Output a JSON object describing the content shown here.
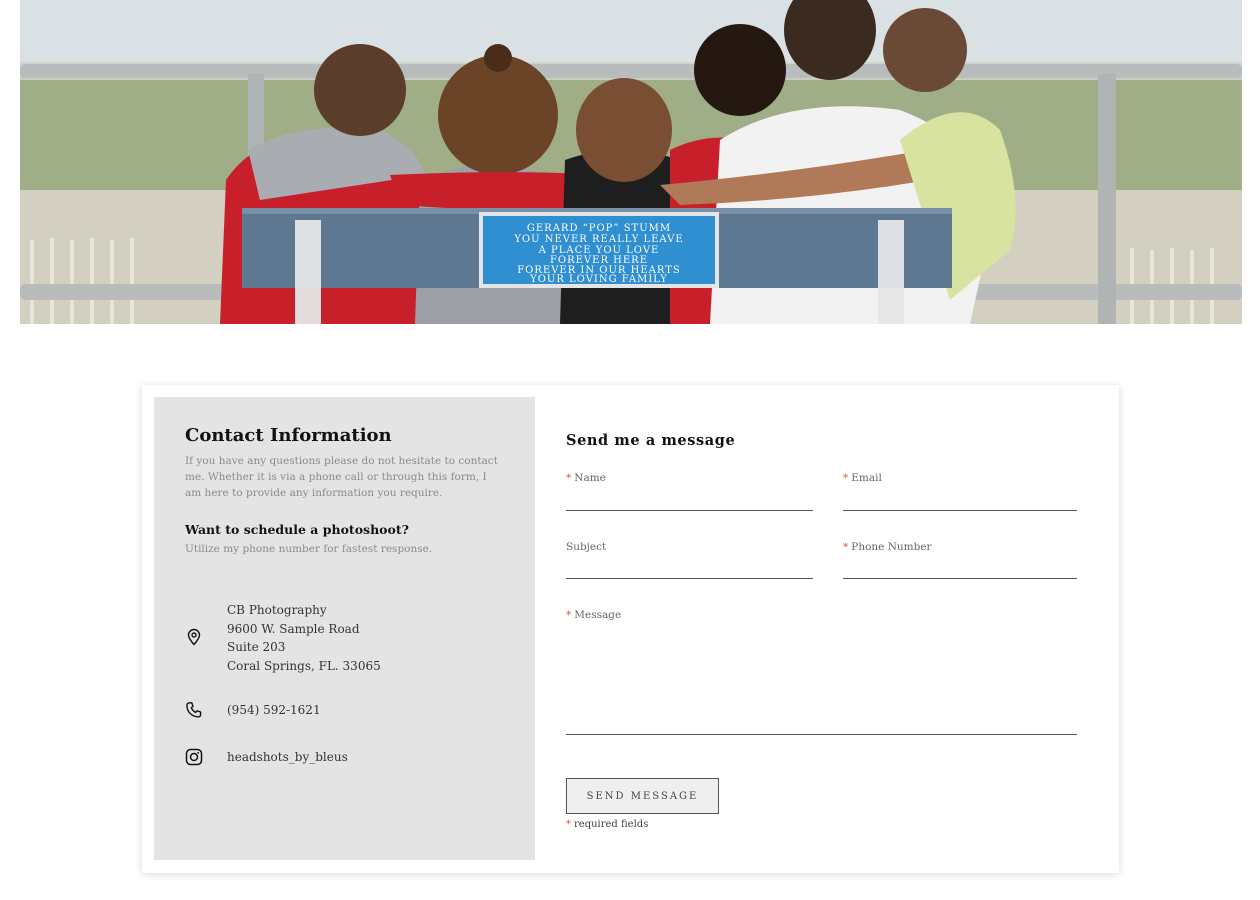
{
  "hero": {
    "plaque_lines": [
      "GERARD “POP” STUMM",
      "YOU NEVER REALLY LEAVE",
      "A PLACE YOU LOVE",
      "FOREVER HERE",
      "FOREVER IN OUR HEARTS",
      "YOUR LOVING FAMILY"
    ]
  },
  "info": {
    "title": "Contact Information",
    "intro": "If you have any questions please do not hesitate to contact me. Whether it is via a phone call or through this form, I am here to provide any information you require.",
    "schedule_title": "Want to schedule a photoshoot?",
    "schedule_note": "Utilize my phone number for fastest response.",
    "address_lines": [
      "CB Photography",
      "9600 W. Sample Road",
      "Suite 203",
      "Coral Springs, FL. 33065"
    ],
    "phone": "(954) 592-1621",
    "instagram": "headshots_by_bleus",
    "icons": {
      "address": "map-pin-icon",
      "phone": "phone-icon",
      "instagram": "instagram-icon"
    }
  },
  "form": {
    "title": "Send me a message",
    "required_mark": "*",
    "fields": {
      "name": {
        "label": "Name",
        "value": ""
      },
      "email": {
        "label": "Email",
        "value": ""
      },
      "subject": {
        "label": "Subject",
        "value": ""
      },
      "phone": {
        "label": "Phone Number",
        "value": ""
      },
      "message": {
        "label": "Message",
        "value": ""
      }
    },
    "submit_label": "SEND MESSAGE",
    "required_note": "required fields"
  },
  "colors": {
    "required": "#e0533d",
    "panel": "#e4e4e4",
    "plaque": "#2f8fd0"
  }
}
